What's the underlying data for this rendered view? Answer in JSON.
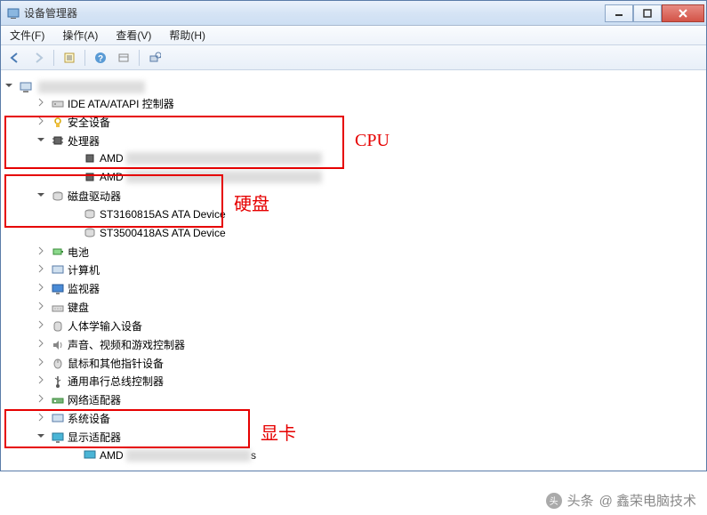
{
  "window": {
    "title": "设备管理器"
  },
  "menu": {
    "file": "文件(F)",
    "action": "操作(A)",
    "view": "查看(V)",
    "help": "帮助(H)"
  },
  "tree": {
    "root": "（隐藏的计算机名）",
    "ide": "IDE ATA/ATAPI 控制器",
    "security": "安全设备",
    "cpu_cat": "处理器",
    "cpu_0": "AMD",
    "cpu_1": "AMD",
    "disk_cat": "磁盘驱动器",
    "disk_0": "ST3160815AS ATA Device",
    "disk_1": "ST3500418AS ATA Device",
    "battery": "电池",
    "computer": "计算机",
    "monitor": "监视器",
    "keyboard": "键盘",
    "hid": "人体学输入设备",
    "sound": "声音、视频和游戏控制器",
    "mouse": "鼠标和其他指针设备",
    "usb": "通用串行总线控制器",
    "network": "网络适配器",
    "system": "系统设备",
    "display_cat": "显示适配器",
    "display_0": "AMD"
  },
  "annotations": {
    "cpu": "CPU",
    "disk": "硬盘",
    "gpu": "显卡"
  },
  "watermark": {
    "prefix": "头条",
    "author": "@ 鑫荣电脑技术"
  }
}
